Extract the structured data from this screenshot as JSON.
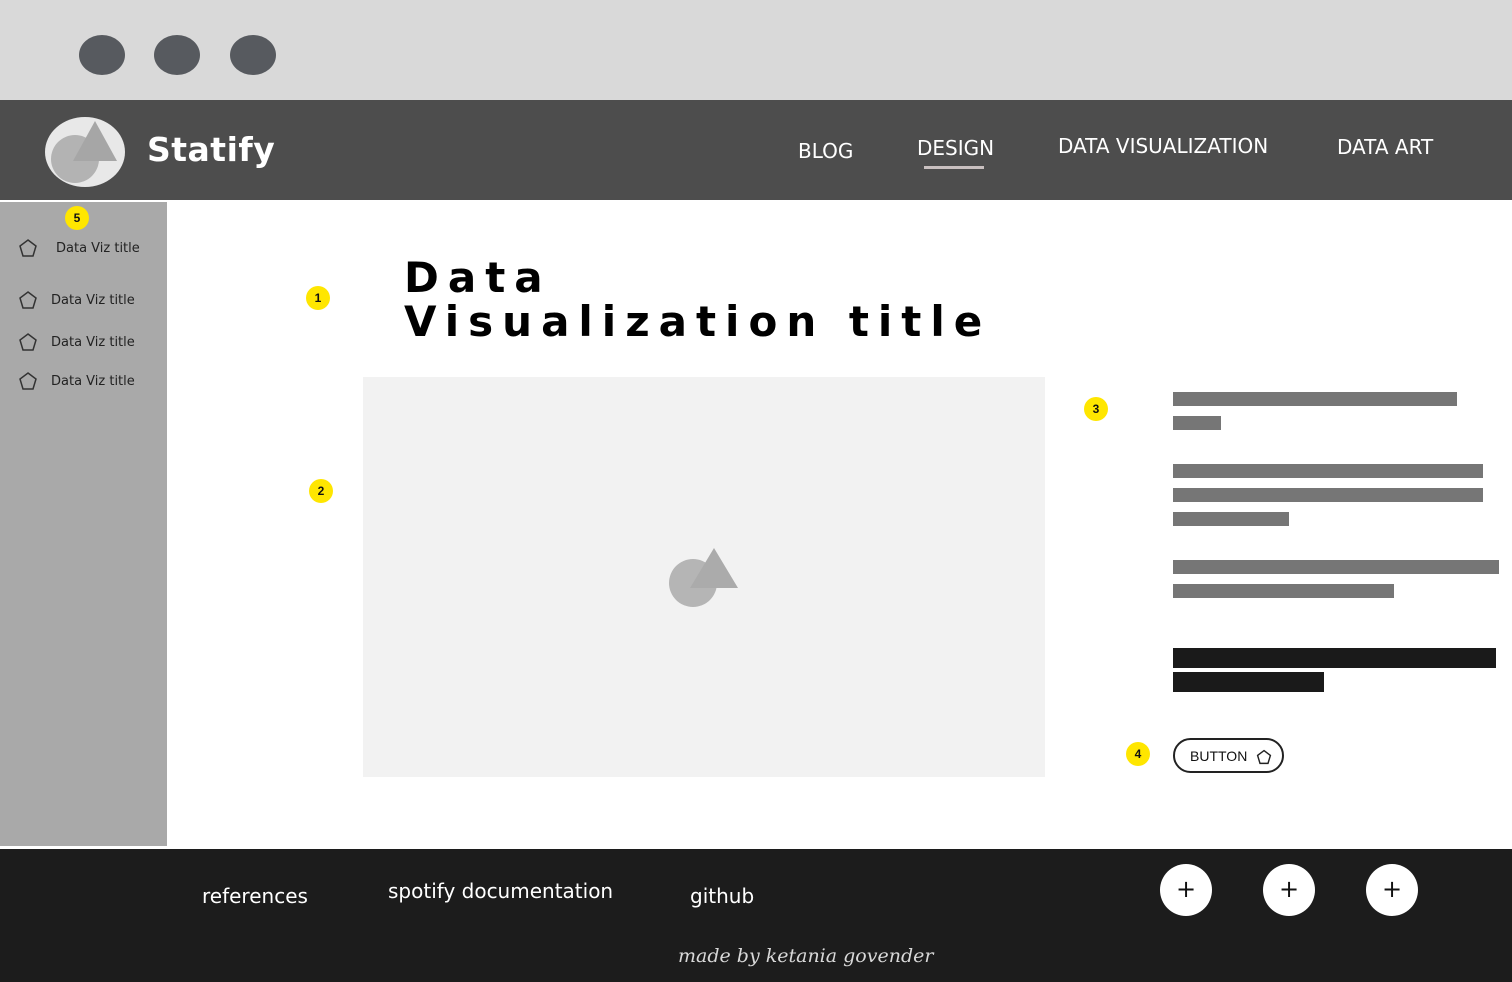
{
  "browser": {
    "window_controls": [
      "control-dot-1",
      "control-dot-2",
      "control-dot-3"
    ]
  },
  "header": {
    "brand": "Statify",
    "logo_icon": "circle-triangle-logo",
    "nav": {
      "blog": "BLOG",
      "design": "DESIGN",
      "data_visualization": "DATA VISUALIZATION",
      "data_art": "DATA ART"
    },
    "active_nav": "DESIGN"
  },
  "sidebar": {
    "badge": "5",
    "items": [
      {
        "label": "Data Viz title",
        "icon": "pentagon-icon"
      },
      {
        "label": "Data Viz title",
        "icon": "pentagon-icon"
      },
      {
        "label": "Data Viz title",
        "icon": "pentagon-icon"
      },
      {
        "label": "Data Viz title",
        "icon": "pentagon-icon"
      }
    ]
  },
  "main": {
    "badges": {
      "title": "1",
      "image": "2",
      "text": "3",
      "button": "4"
    },
    "title_line1": "Data",
    "title_line2": "Visualization title",
    "image_icon": "image-placeholder-icon",
    "button_label": "BUTTON"
  },
  "footer": {
    "links": {
      "references": "references",
      "spotify": "spotify documentation",
      "github": "github"
    },
    "plus_buttons": [
      "+",
      "+",
      "+"
    ],
    "credit": "made by ketania govender"
  },
  "colors": {
    "chrome": "#d9d9d9",
    "header": "#4d4d4d",
    "sidebar": "#a9a9a9",
    "badge": "#ffe600",
    "footer": "#1c1c1c",
    "placeholder": "#f2f2f2"
  }
}
